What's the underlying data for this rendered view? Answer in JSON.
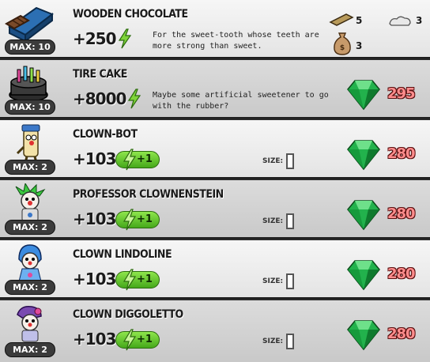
{
  "items": [
    {
      "name": "WOODEN CHOCOLATE",
      "max": "MAX: 10",
      "points": "+250",
      "description": "For the sweet-tooth whose teeth are more strong than sweet.",
      "materials": [
        {
          "icon": "plank-icon",
          "count": "5"
        },
        {
          "icon": "rock-icon",
          "count": "3"
        },
        {
          "icon": "sack-icon",
          "count": "3"
        }
      ]
    },
    {
      "name": "TIRE CAKE",
      "max": "MAX: 10",
      "points": "+8000",
      "description": "Maybe some artificial sweetener to go with the rubber?",
      "price": "295"
    },
    {
      "name": "CLOWN-BOT",
      "max": "MAX: 2",
      "points": "+103",
      "boost": "+1",
      "size_label": "SIZE:",
      "price": "280"
    },
    {
      "name": "PROFESSOR CLOWNENSTEIN",
      "max": "MAX: 2",
      "points": "+103",
      "boost": "+1",
      "size_label": "SIZE:",
      "price": "280"
    },
    {
      "name": "CLOWN LINDOLINE",
      "max": "MAX: 2",
      "points": "+103",
      "boost": "+1",
      "size_label": "SIZE:",
      "price": "280"
    },
    {
      "name": "CLOWN DIGGOLETTO",
      "max": "MAX: 2",
      "points": "+103",
      "boost": "+1",
      "size_label": "SIZE:",
      "price": "280"
    }
  ],
  "colors": {
    "gem": "#22b24c",
    "price_text": "#ff8d8d",
    "boost_pill": "#6ccf2f"
  }
}
